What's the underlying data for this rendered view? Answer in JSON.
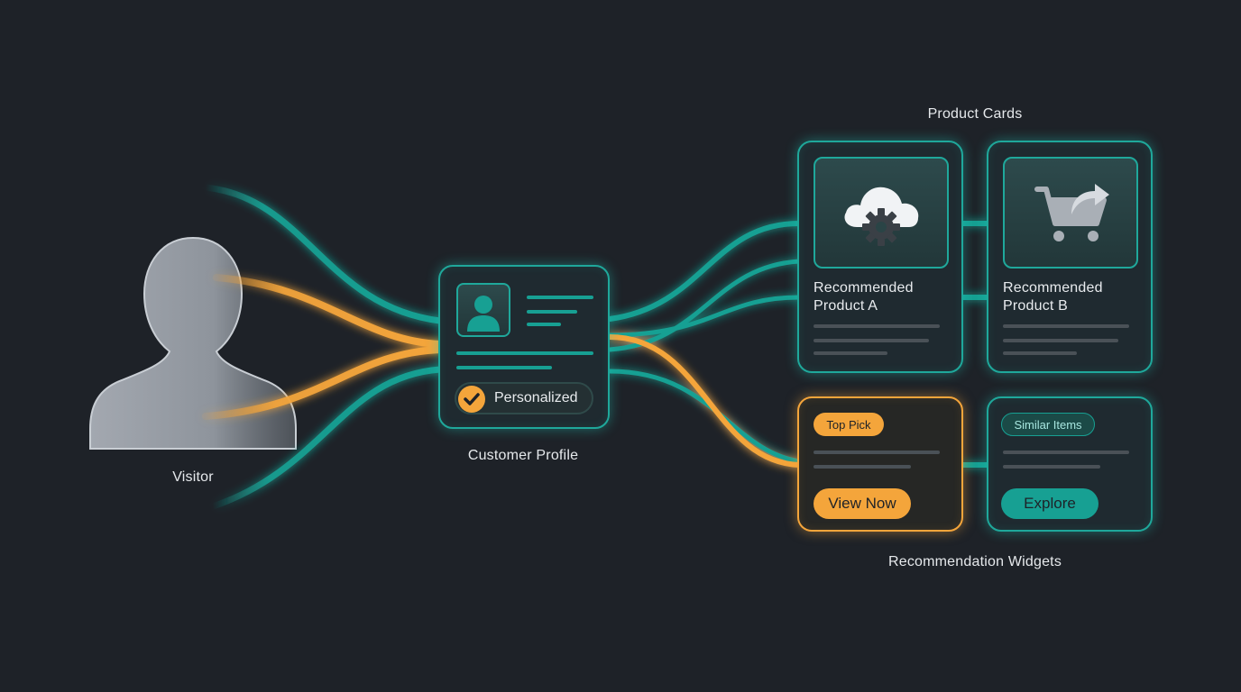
{
  "labels": {
    "visitor": "Visitor",
    "customer_profile": "Customer Profile",
    "product_cards": "Product Cards",
    "recommendation_widgets": "Recommendation Widgets"
  },
  "profile_card": {
    "badge": "Personalized"
  },
  "product_a": {
    "line1": "Recommended",
    "line2": "Product A",
    "icon": "cloud-gear-icon"
  },
  "product_b": {
    "line1": "Recommended",
    "line2": "Product B",
    "icon": "cart-share-icon"
  },
  "widget_top": {
    "tag": "Top Pick",
    "button": "View Now"
  },
  "widget_similar": {
    "tag": "Similar Items",
    "button": "Explore"
  },
  "colors": {
    "background": "#1e2228",
    "teal": "#1fa89b",
    "orange": "#f4a53b",
    "silhouette": "#9aa0a8"
  }
}
